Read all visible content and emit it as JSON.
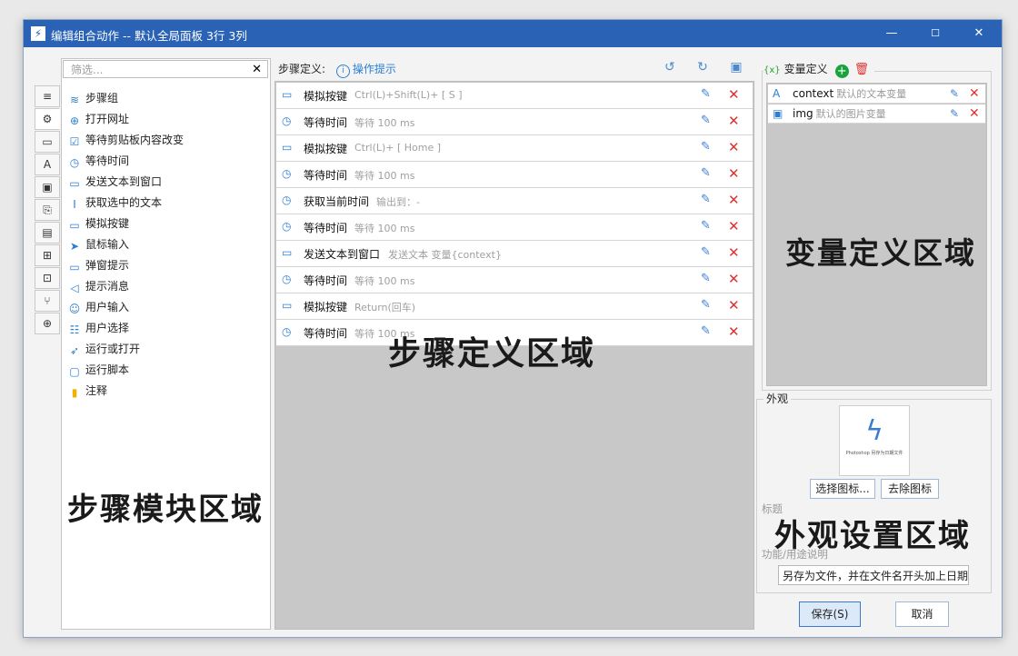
{
  "window": {
    "title": "编辑组合动作 -- 默认全局面板 3行 3列",
    "min": "—",
    "max": "☐",
    "close": "✕",
    "app_icon": "⚡"
  },
  "vertical_tabs": [
    {
      "icon": "≡",
      "name": "list-icon"
    },
    {
      "icon": "⚙",
      "name": "gear-icon"
    },
    {
      "icon": "▭",
      "name": "window-icon"
    },
    {
      "icon": "A",
      "name": "text-icon"
    },
    {
      "icon": "▣",
      "name": "image-icon"
    },
    {
      "icon": "⎘",
      "name": "clipboard-icon"
    },
    {
      "icon": "▤",
      "name": "document-icon"
    },
    {
      "icon": "⊞",
      "name": "windows-icon"
    },
    {
      "icon": "⊡",
      "name": "grid-icon"
    },
    {
      "icon": "⑂",
      "name": "branch-icon"
    },
    {
      "icon": "⊕",
      "name": "globe-icon"
    }
  ],
  "modules": {
    "filter_placeholder": "筛选...",
    "filter_clear": "✕",
    "items": [
      {
        "label": "步骤组",
        "icon": "≋"
      },
      {
        "label": "打开网址",
        "icon": "⊕"
      },
      {
        "label": "等待剪贴板内容改变",
        "icon": "☑"
      },
      {
        "label": "等待时间",
        "icon": "◷"
      },
      {
        "label": "发送文本到窗口",
        "icon": "▭"
      },
      {
        "label": "获取选中的文本",
        "icon": "I"
      },
      {
        "label": "模拟按键",
        "icon": "▭"
      },
      {
        "label": "鼠标输入",
        "icon": "➤"
      },
      {
        "label": "弹窗提示",
        "icon": "▭"
      },
      {
        "label": "提示消息",
        "icon": "◁"
      },
      {
        "label": "用户输入",
        "icon": "☺"
      },
      {
        "label": "用户选择",
        "icon": "☷"
      },
      {
        "label": "运行或打开",
        "icon": "➶"
      },
      {
        "label": "运行脚本",
        "icon": "▢"
      },
      {
        "label": "注释",
        "icon": "▮"
      }
    ],
    "area_label": "步骤模块区域"
  },
  "steps": {
    "header_label": "步骤定义:",
    "hint_label": "操作提示",
    "tools": "↺ ↻ ▣ ⟲",
    "edit_icon": "✎",
    "delete_icon": "✕",
    "items": [
      {
        "name": "模拟按键",
        "desc": "Ctrl(L)+Shift(L)+ [ S ]",
        "icon": "▭"
      },
      {
        "name": "等待时间",
        "desc": "等待 100 ms",
        "icon": "◷"
      },
      {
        "name": "模拟按键",
        "desc": "Ctrl(L)+ [ Home ]",
        "icon": "▭"
      },
      {
        "name": "等待时间",
        "desc": "等待 100 ms",
        "icon": "◷"
      },
      {
        "name": "获取当前时间",
        "desc": "输出到：-",
        "icon": "◷"
      },
      {
        "name": "等待时间",
        "desc": "等待 100 ms",
        "icon": "◷"
      },
      {
        "name": "发送文本到窗口",
        "desc": "发送文本 变量{context}",
        "icon": "▭"
      },
      {
        "name": "等待时间",
        "desc": "等待 100 ms",
        "icon": "◷"
      },
      {
        "name": "模拟按键",
        "desc": "Return(回车)",
        "icon": "▭"
      },
      {
        "name": "等待时间",
        "desc": "等待 100 ms",
        "icon": "◷"
      }
    ],
    "area_label": "步骤定义区域"
  },
  "variables": {
    "header_label": "变量定义",
    "header_icon": "{x}",
    "add_icon": "+",
    "delete_icon": "🗑",
    "items": [
      {
        "name": "context",
        "desc": "默认的文本变量",
        "icon": "A"
      },
      {
        "name": "img",
        "desc": "默认的图片变量",
        "icon": "▣"
      }
    ],
    "area_label": "变量定义区域"
  },
  "appearance": {
    "legend": "外观",
    "preview_icon": "ϟ",
    "preview_text": "Photoshop 另存为日期文件",
    "choose_icon_label": "选择图标...",
    "remove_icon_label": "去除图标",
    "title_label": "标题",
    "desc_label": "功能/用途说明",
    "desc_value": "另存为文件，并在文件名开头加上日期",
    "area_label": "外观设置区域"
  },
  "footer": {
    "save_label": "保存(S)",
    "cancel_label": "取消"
  }
}
